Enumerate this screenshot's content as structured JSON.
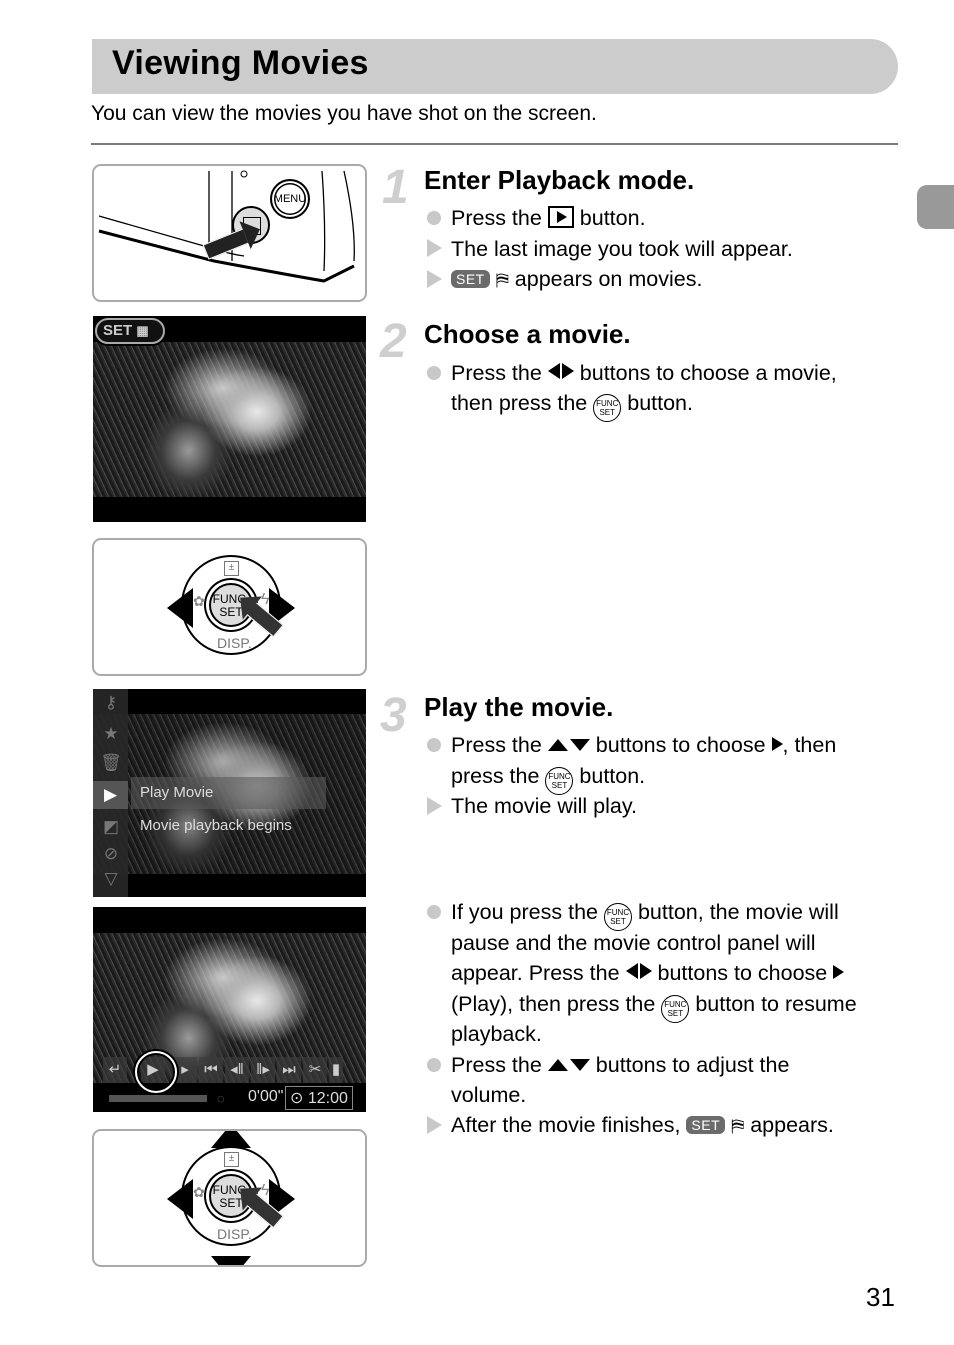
{
  "page": {
    "title": "Viewing Movies",
    "intro": "You can view the movies you have shot on the screen.",
    "page_number": "31"
  },
  "steps": [
    {
      "number": "1",
      "title": "Enter Playback mode.",
      "lines": [
        {
          "bullet": "dot",
          "before": "Press the",
          "icon": "playback-button-icon",
          "after": "button."
        },
        {
          "bullet": "triangle",
          "text": "The last image you took will appear."
        },
        {
          "bullet": "triangle",
          "badge": "SET",
          "icon": "movie-icon",
          "after": "appears on movies."
        }
      ]
    },
    {
      "number": "2",
      "title": "Choose a movie.",
      "lines": [
        {
          "bullet": "dot",
          "before": "Press the",
          "icon": "left-right-buttons-icon",
          "after": "buttons to choose a movie,"
        },
        {
          "bullet": "none",
          "before": "then press the",
          "icon": "func-set-button-icon",
          "after": "button."
        }
      ]
    },
    {
      "number": "3",
      "title": "Play the movie.",
      "lines": [
        {
          "bullet": "dot",
          "before": "Press the",
          "icon": "up-down-buttons-icon",
          "middle": "buttons to choose",
          "icon2": "play-icon",
          "after": ", then"
        },
        {
          "bullet": "none",
          "before": "press the",
          "icon": "func-set-button-icon",
          "after": "button."
        },
        {
          "bullet": "triangle",
          "text": "The movie will play."
        }
      ]
    }
  ],
  "notes": [
    {
      "bullet": "dot",
      "l1_before": "If you press the",
      "l1_after": "button, the movie will",
      "l2": "pause and the movie control panel will",
      "l3_before": "appear. Press the",
      "l3_after": "buttons to choose",
      "l4_before": "(Play), then press the",
      "l4_after": "button to resume",
      "l5": "playback."
    },
    {
      "bullet": "dot",
      "l1_before": "Press the",
      "l1_after": "buttons to adjust the",
      "l2": "volume."
    },
    {
      "bullet": "triangle",
      "before": "After the movie finishes,",
      "badge": "SET",
      "after": "appears."
    }
  ],
  "illustrations": {
    "camera": {
      "menu_label": "MENU"
    },
    "screen1": {
      "badge": "SET"
    },
    "dial": {
      "center_l1": "FUNC.",
      "center_l2": "SET",
      "bottom": "DISP.",
      "ev": "±"
    },
    "menu_screen": {
      "item_label": "Play Movie",
      "item_desc": "Movie playback begins"
    },
    "control_screen": {
      "elapsed": "0'00\"",
      "clock": "12:00"
    }
  },
  "icons": {
    "func_l1": "FUNC",
    "func_l2": "SET",
    "movie": "🎞"
  }
}
